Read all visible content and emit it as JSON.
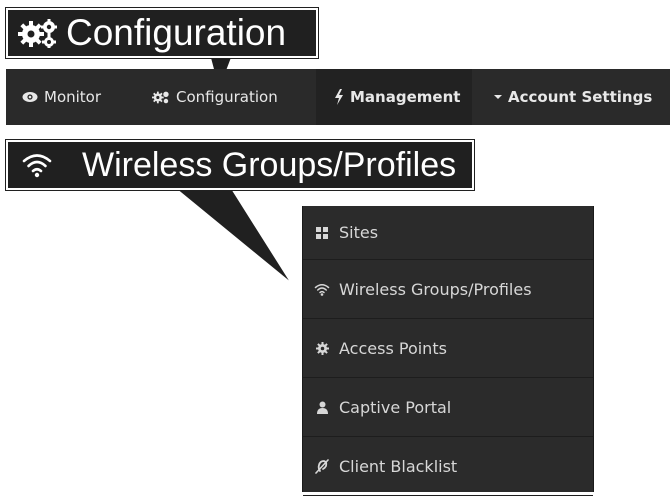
{
  "callouts": {
    "configuration": "Configuration",
    "wireless": "Wireless Groups/Profiles"
  },
  "navbar": {
    "items": [
      {
        "label": "Monitor",
        "icon": "eye-icon"
      },
      {
        "label": "Configuration",
        "icon": "gears-icon"
      },
      {
        "label": "Management",
        "icon": "bolt-icon"
      },
      {
        "label": "Account Settings",
        "icon": "caret-down-icon"
      }
    ]
  },
  "menu": {
    "items": [
      {
        "label": "Sites",
        "icon": "grid-icon"
      },
      {
        "label": "Wireless Groups/Profiles",
        "icon": "wifi-icon"
      },
      {
        "label": "Access Points",
        "icon": "gear-icon"
      },
      {
        "label": "Captive Portal",
        "icon": "user-icon"
      },
      {
        "label": "Client Blacklist",
        "icon": "deaf-icon"
      }
    ]
  },
  "colors": {
    "callout_bg": "#202020",
    "navbar_bg": "#2a2a2a",
    "menu_bg": "#2b2b2b"
  }
}
